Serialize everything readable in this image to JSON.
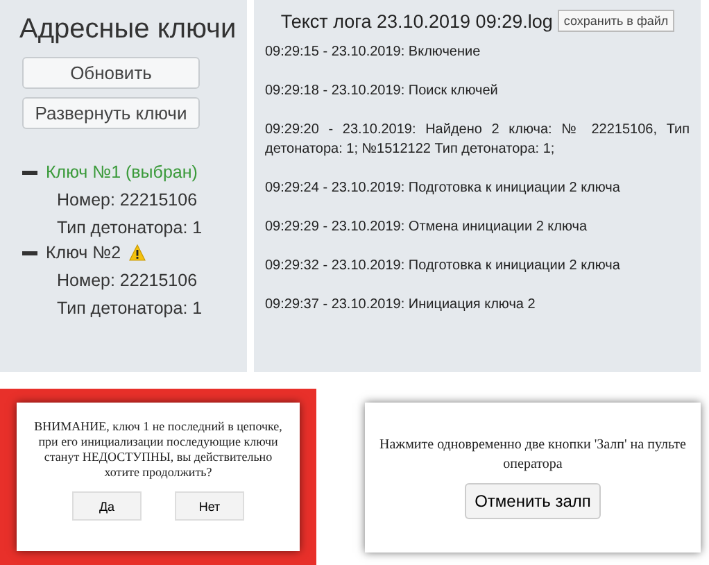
{
  "keys_panel": {
    "title": "Адресные ключи",
    "buttons": [
      "Обновить",
      "Развернуть ключи"
    ],
    "keys": [
      {
        "label": "Ключ №1 (выбран)",
        "selected": true,
        "warning": false,
        "number": "Номер: 22215106",
        "detonator_type": "Тип детонатора: 1"
      },
      {
        "label": "Ключ №2",
        "selected": false,
        "warning": true,
        "number": "Номер: 22215106",
        "detonator_type": "Тип детонатора: 1"
      }
    ]
  },
  "log_panel": {
    "title": "Текст лога 23.10.2019 09:29.log",
    "save_button": "сохранить в файл",
    "entries": [
      "09:29:15 - 23.10.2019: Включение",
      "09:29:18 - 23.10.2019: Поиск ключей",
      "09:29:20 - 23.10.2019: Найдено 2 ключа: № 22215106, Тип детонатора: 1; №1512122 Тип детонатора: 1;",
      "09:29:24 - 23.10.2019: Подготовка к инициации 2 ключа",
      "09:29:29 - 23.10.2019: Отмена инициации 2 ключа",
      "09:29:32 - 23.10.2019: Подготовка к инициации 2 ключа",
      "09:29:37 - 23.10.2019: Инициация ключа 2"
    ]
  },
  "confirm_dialog": {
    "message": "ВНИМАНИЕ, ключ 1 не последний в цепочке, при его инициализации последующие ключи станут НЕДОСТУПНЫ, вы действительно хотите продолжить?",
    "buttons": [
      "Да",
      "Нет"
    ]
  },
  "salvo_dialog": {
    "message": "Нажмите одновременно две кнопки 'Залп' на пульте оператора",
    "button": "Отменить залп"
  }
}
